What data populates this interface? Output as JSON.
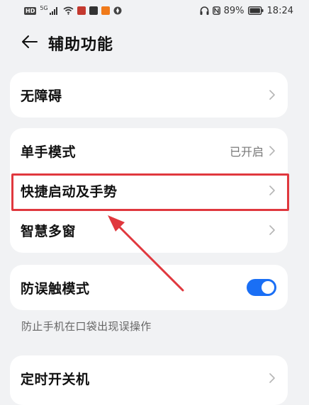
{
  "status_bar": {
    "left_badge": "HD",
    "network_label": "5G",
    "battery_percent": "89%",
    "time": "18:24"
  },
  "header": {
    "title": "辅助功能"
  },
  "cards": {
    "accessibility": {
      "label": "无障碍"
    },
    "one_handed": {
      "label": "单手模式",
      "status": "已开启"
    },
    "shortcuts": {
      "label": "快捷启动及手势"
    },
    "smart_window": {
      "label": "智慧多窗"
    },
    "mistouch": {
      "label": "防误触模式",
      "enabled": true,
      "description": "防止手机在口袋出现误操作"
    },
    "scheduled_power": {
      "label": "定时开关机"
    }
  },
  "colors": {
    "accent": "#1a6ff5",
    "annotation": "#e0383e",
    "background": "#f1f2f4"
  }
}
